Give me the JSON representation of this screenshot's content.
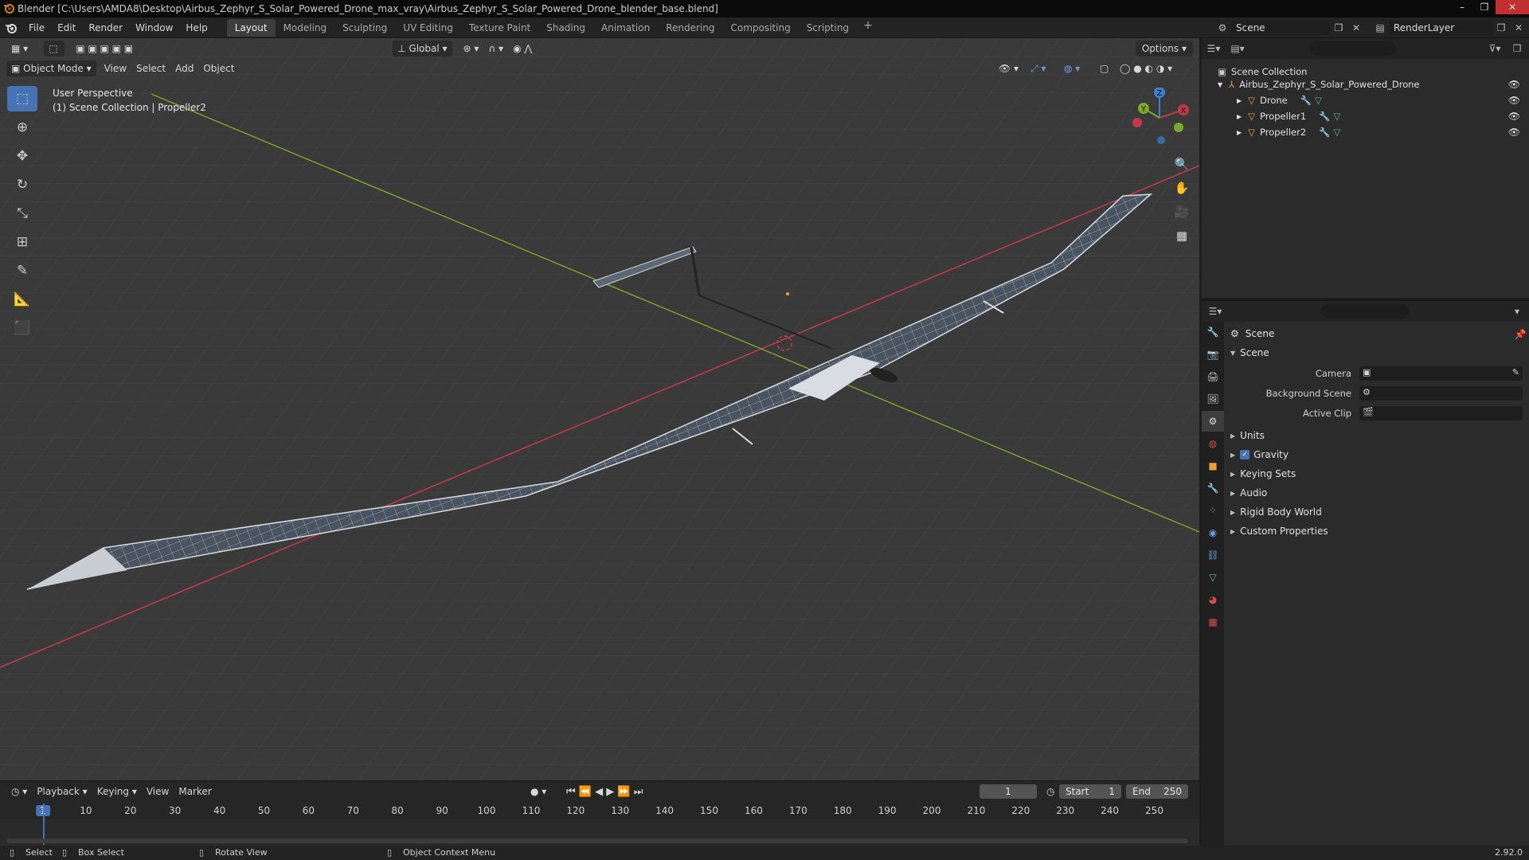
{
  "titlebar": {
    "title": "Blender [C:\\Users\\AMDA8\\Desktop\\Airbus_Zephyr_S_Solar_Powered_Drone_max_vray\\Airbus_Zephyr_S_Solar_Powered_Drone_blender_base.blend]",
    "minimize": "–",
    "maximize": "❐",
    "close": "✕"
  },
  "menu": [
    "File",
    "Edit",
    "Render",
    "Window",
    "Help"
  ],
  "workspaces": [
    "Layout",
    "Modeling",
    "Sculpting",
    "UV Editing",
    "Texture Paint",
    "Shading",
    "Animation",
    "Rendering",
    "Compositing",
    "Scripting"
  ],
  "active_workspace": "Layout",
  "scene_selector": "Scene",
  "render_layer": "RenderLayer",
  "viewport": {
    "transform_orientation": "Global",
    "options": "Options",
    "mode": "Object Mode",
    "menus": [
      "View",
      "Select",
      "Add",
      "Object"
    ],
    "perspective": "User Perspective",
    "collection_info": "(1) Scene Collection | Propeller2",
    "gizmo": {
      "x": "X",
      "y": "Y",
      "z": "Z"
    }
  },
  "outliner": {
    "root": "Scene Collection",
    "items": [
      {
        "name": "Airbus_Zephyr_S_Solar_Powered_Drone",
        "level": 0
      },
      {
        "name": "Drone",
        "level": 1
      },
      {
        "name": "Propeller1",
        "level": 1
      },
      {
        "name": "Propeller2",
        "level": 1
      }
    ]
  },
  "properties": {
    "title": "Scene",
    "section": "Scene",
    "fields": [
      {
        "label": "Camera",
        "value": ""
      },
      {
        "label": "Background Scene",
        "value": ""
      },
      {
        "label": "Active Clip",
        "value": ""
      }
    ],
    "panels": [
      "Units",
      "Gravity",
      "Keying Sets",
      "Audio",
      "Rigid Body World",
      "Custom Properties"
    ],
    "gravity_enabled": true
  },
  "timeline": {
    "menus": [
      "Playback",
      "Keying",
      "View",
      "Marker"
    ],
    "current_frame": "1",
    "start_label": "Start",
    "start": "1",
    "end_label": "End",
    "end": "250",
    "ticks": [
      "1",
      "10",
      "20",
      "30",
      "40",
      "50",
      "60",
      "70",
      "80",
      "90",
      "100",
      "110",
      "120",
      "130",
      "140",
      "150",
      "160",
      "170",
      "180",
      "190",
      "200",
      "210",
      "220",
      "230",
      "240",
      "250"
    ]
  },
  "statusbar": {
    "select": "Select",
    "box_select": "Box Select",
    "rotate_view": "Rotate View",
    "context_menu": "Object Context Menu",
    "version": "2.92.0"
  },
  "colors": {
    "accent": "#4772b3",
    "x_axis": "#c0394a",
    "y_axis": "#7ea72e",
    "z_axis": "#3b7fd1",
    "viewport_bg": "#3a3a3a"
  }
}
